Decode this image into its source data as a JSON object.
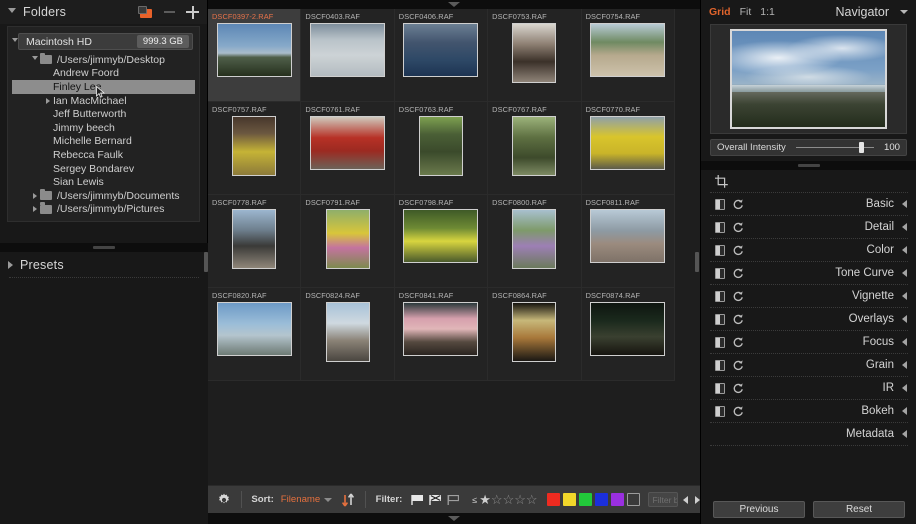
{
  "left": {
    "folders_title": "Folders",
    "icons": {
      "new_folder": "new-folder-icon",
      "minus": "minus-icon",
      "plus": "plus-icon"
    },
    "volume": {
      "name": "Macintosh HD",
      "size": "999.3 GB"
    },
    "tree": [
      {
        "label": "/Users/jimmyb/Desktop",
        "type": "folder",
        "twist": "open",
        "indent": 1
      },
      {
        "label": "Andrew Foord",
        "type": "leaf",
        "twist": "none",
        "indent": 2
      },
      {
        "label": "Finley Lee",
        "type": "leaf",
        "twist": "none",
        "indent": 2,
        "selected": true
      },
      {
        "label": "Ian MacMichael",
        "type": "leaf",
        "twist": "closed",
        "indent": 2
      },
      {
        "label": "Jeff Butterworth",
        "type": "leaf",
        "twist": "none",
        "indent": 2
      },
      {
        "label": "Jimmy beech",
        "type": "leaf",
        "twist": "none",
        "indent": 2
      },
      {
        "label": "Michelle Bernard",
        "type": "leaf",
        "twist": "none",
        "indent": 2
      },
      {
        "label": "Rebecca Faulk",
        "type": "leaf",
        "twist": "none",
        "indent": 2
      },
      {
        "label": "Sergey Bondarev",
        "type": "leaf",
        "twist": "none",
        "indent": 2
      },
      {
        "label": "Sian Lewis",
        "type": "leaf",
        "twist": "none",
        "indent": 2
      },
      {
        "label": "/Users/jimmyb/Documents",
        "type": "folder",
        "twist": "closed",
        "indent": 1
      },
      {
        "label": "/Users/jimmyb/Pictures",
        "type": "folder",
        "twist": "closed",
        "indent": 1
      }
    ],
    "presets_title": "Presets"
  },
  "grid": {
    "rows": [
      [
        {
          "name": "DSCF0397-2.RAF",
          "selected": true,
          "orient": "land",
          "scene": "beach"
        },
        {
          "name": "DSCF0403.RAF",
          "orient": "land",
          "scene": "sanddunes"
        },
        {
          "name": "DSCF0406.RAF",
          "orient": "land",
          "scene": "kids"
        },
        {
          "name": "DSCF0753.RAF",
          "orient": "port",
          "scene": "horse"
        },
        {
          "name": "DSCF0754.RAF",
          "orient": "land",
          "scene": "fairground"
        }
      ],
      [
        {
          "name": "DSCF0757.RAF",
          "orient": "port",
          "scene": "market"
        },
        {
          "name": "DSCF0761.RAF",
          "orient": "land",
          "scene": "redmachine"
        },
        {
          "name": "DSCF0763.RAF",
          "orient": "port",
          "scene": "statue"
        },
        {
          "name": "DSCF0767.RAF",
          "orient": "port",
          "scene": "woods"
        },
        {
          "name": "DSCF0770.RAF",
          "orient": "land",
          "scene": "yellowcart"
        }
      ],
      [
        {
          "name": "DSCF0778.RAF",
          "orient": "port",
          "scene": "plane"
        },
        {
          "name": "DSCF0791.RAF",
          "orient": "port",
          "scene": "flowers"
        },
        {
          "name": "DSCF0798.RAF",
          "orient": "land",
          "scene": "orchid"
        },
        {
          "name": "DSCF0800.RAF",
          "orient": "port",
          "scene": "stilts"
        },
        {
          "name": "DSCF0811.RAF",
          "orient": "land",
          "scene": "crowd"
        }
      ],
      [
        {
          "name": "DSCF0820.RAF",
          "orient": "land",
          "scene": "skyline"
        },
        {
          "name": "DSCF0824.RAF",
          "orient": "port",
          "scene": "cyclist"
        },
        {
          "name": "DSCF0841.RAF",
          "orient": "land",
          "scene": "sunset"
        },
        {
          "name": "DSCF0864.RAF",
          "orient": "port",
          "scene": "stall"
        },
        {
          "name": "DSCF0874.RAF",
          "orient": "land",
          "scene": "lanterns"
        }
      ]
    ]
  },
  "toolbar": {
    "gear_icon": "gear-icon",
    "sort_label": "Sort:",
    "sort_value": "Filename",
    "sort_dir_icon": "sort-direction-icon",
    "filter_label": "Filter:",
    "flags": [
      "flag-pick-icon",
      "flag-reject-icon",
      "flag-unflagged-icon"
    ],
    "rating_op": "≤",
    "stars_total": 5,
    "stars_filled": 1,
    "colors": [
      "#ee2b20",
      "#f2d72a",
      "#22c93a",
      "#1b2fdb",
      "#9a2fe0"
    ],
    "color_none_label": "no-color-swatch",
    "filter_placeholder": "Filter by me",
    "prev_icon": "prev-arrow-icon",
    "next_icon": "next-arrow-icon"
  },
  "right": {
    "view_modes": [
      "Grid",
      "Fit",
      "1:1"
    ],
    "active_view_mode": "Grid",
    "navigator_title": "Navigator",
    "navigator_caret": "chevron-down-icon",
    "intensity": {
      "label": "Overall Intensity",
      "value": "100"
    },
    "crop_icon": "crop-icon",
    "sections": [
      {
        "label": "Basic"
      },
      {
        "label": "Detail"
      },
      {
        "label": "Color"
      },
      {
        "label": "Tone Curve"
      },
      {
        "label": "Vignette"
      },
      {
        "label": "Overlays"
      },
      {
        "label": "Focus"
      },
      {
        "label": "Grain"
      },
      {
        "label": "IR"
      },
      {
        "label": "Bokeh"
      }
    ],
    "metadata_label": "Metadata",
    "previous_button": "Previous",
    "reset_button": "Reset"
  },
  "colors": {
    "accent": "#e4703e",
    "panel_bg": "#181818",
    "grid_bg": "#1e1e1e",
    "toolbar_bg": "#3a3a3a",
    "selection": "#8d8d8d"
  }
}
